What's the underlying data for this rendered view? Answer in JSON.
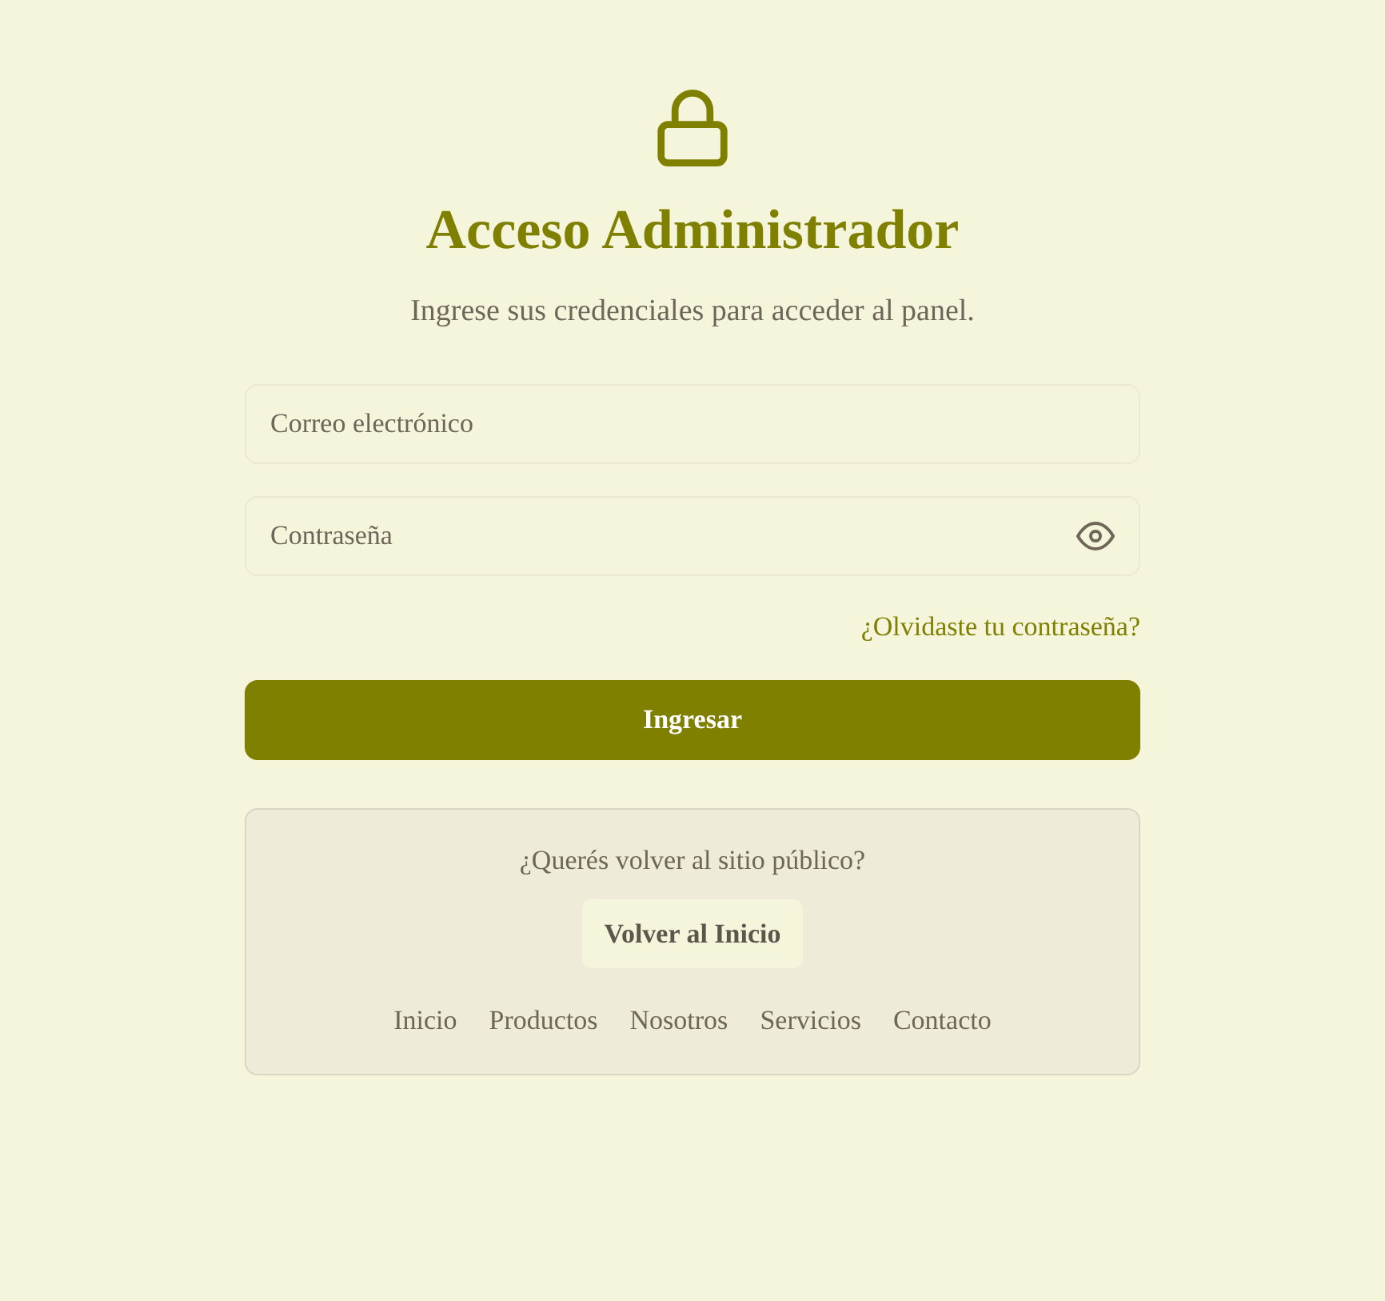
{
  "header": {
    "title": "Acceso Administrador",
    "subtitle": "Ingrese sus credenciales para acceder al panel."
  },
  "form": {
    "fields": [
      {
        "kind": "email",
        "placeholder": "Correo electrónico"
      },
      {
        "kind": "password",
        "placeholder": "Contraseña"
      }
    ],
    "forgot_link": "¿Olvidaste tu contraseña?",
    "submit": "Ingresar"
  },
  "public_site": {
    "prompt": "¿Querés volver al sitio público?",
    "button": "Volver al Inicio",
    "links": [
      "Inicio",
      "Productos",
      "Nosotros",
      "Servicios",
      "Contacto"
    ]
  }
}
